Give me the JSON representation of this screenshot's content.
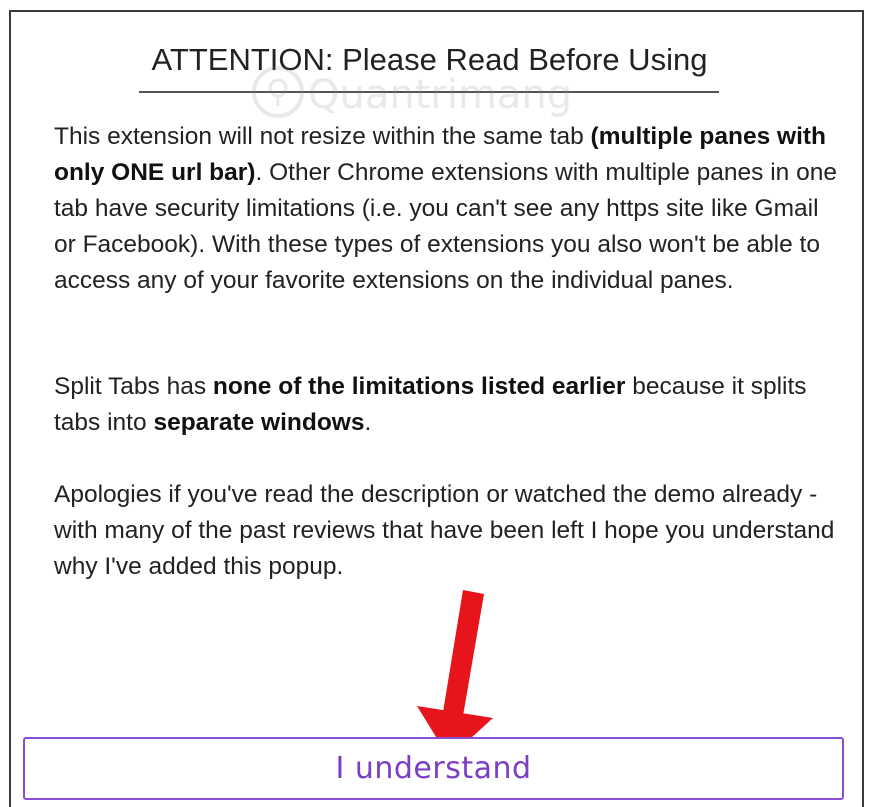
{
  "dialog": {
    "title": "ATTENTION: Please Read Before Using",
    "paragraph1": {
      "t1": "This extension will not resize within the same tab ",
      "b1": "(multiple panes with only ONE url bar)",
      "t2": ". Other Chrome extensions with multiple panes in one tab have security limitations (i.e. you can't see any https site like Gmail or Facebook). With these types of extensions you also won't be able to access any of your favorite extensions on the individual panes."
    },
    "paragraph2": {
      "t1": "Split Tabs has ",
      "b1": "none of the limitations listed earlier",
      "t2": " because it splits tabs into ",
      "b2": "separate windows",
      "t3": "."
    },
    "paragraph3": {
      "t1": "Apologies if you've read the description or watched the demo already - with many of the past reviews that have been left I hope you understand why I've added this popup."
    },
    "confirm_button_label": "I understand"
  },
  "watermark": {
    "text": "Quantrimang",
    "icon": "lightbulb-icon"
  },
  "annotation": {
    "arrow_color": "#e8141b",
    "icon": "down-arrow-icon"
  },
  "colors": {
    "button_border": "#8a4dd6",
    "button_text": "#7a3fc4",
    "text": "#222222"
  }
}
